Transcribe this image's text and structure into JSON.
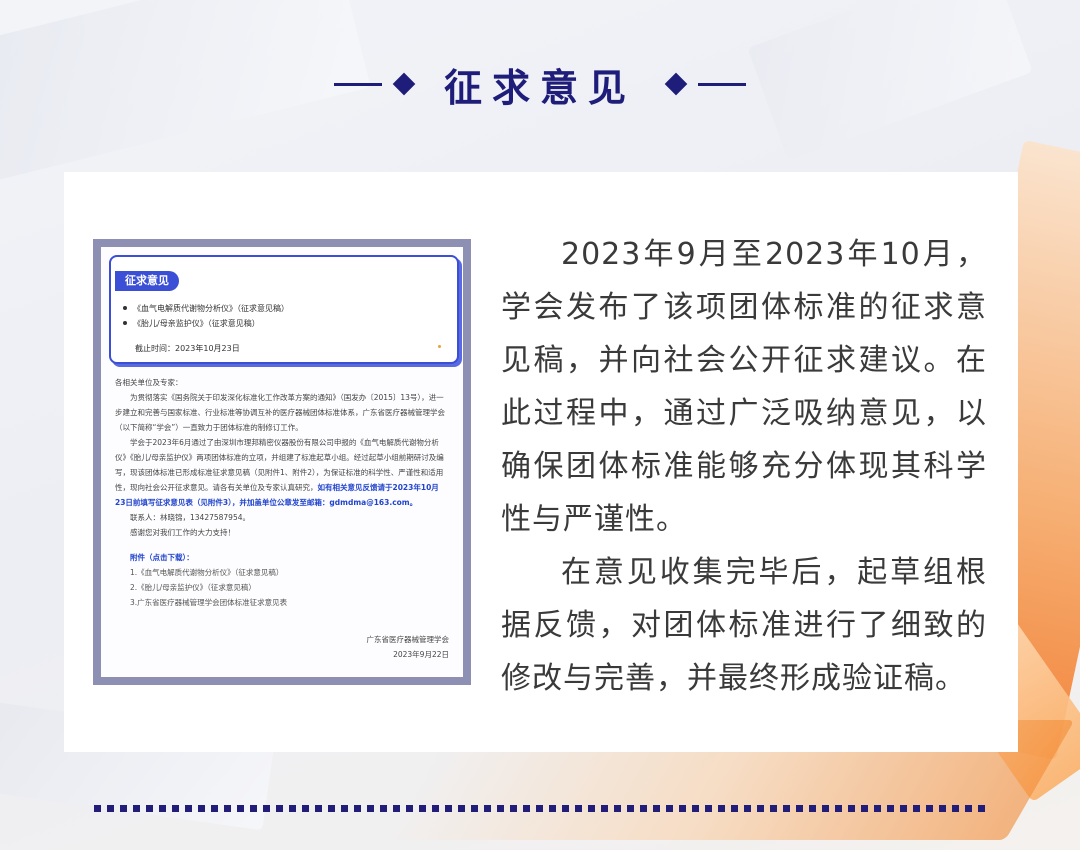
{
  "header": {
    "title": "征求意见"
  },
  "screenshot": {
    "notice": {
      "tab_label": "征求意见",
      "items": [
        "《血气电解质代谢物分析仪》（征求意见稿）",
        "《胎儿/母亲监护仪》（征求意见稿）"
      ],
      "deadline": "截止时间：2023年10月23日"
    },
    "letter": {
      "salutation": "各相关单位及专家：",
      "para1": "为贯彻落实《国务院关于印发深化标准化工作改革方案的通知》（国发办〔2015〕13号），进一步建立和完善与国家标准、行业标准等协调互补的医疗器械团体标准体系，广东省医疗器械管理学会（以下简称“学会”）一直致力于团体标准的制修订工作。",
      "para2": "学会于2023年6月通过了由深圳市理邦精密仪器股份有限公司申报的《血气电解质代谢物分析仪》《胎儿/母亲监护仪》两项团体标准的立项，并组建了标准起草小组。经过起草小组前期研讨及编写，现该团体标准已形成标准征求意见稿（见附件1、附件2），为保证标准的科学性、严谨性和适用性，现向社会公开征求意见。请各有关单位及专家认真研究，",
      "para2_highlight": "如有相关意见反馈请于2023年10月23日前填写征求意见表（见附件3），并加盖单位公章发至邮箱：gdmdma@163.com。",
      "contact": "联系人：林晓锦，13427587954。",
      "thanks": "感谢您对我们工作的大力支持！",
      "attachments_title": "附件（点击下载）：",
      "attachments": [
        "1.《血气电解质代谢物分析仪》（征求意见稿）",
        "2.《胎儿/母亲监护仪》（征求意见稿）",
        "3.广东省医疗器械管理学会团体标准征求意见表"
      ],
      "signature_org": "广东省医疗器械管理学会",
      "signature_date": "2023年9月22日"
    }
  },
  "body": {
    "paragraph1": "2023年9月至2023年10月，学会发布了该项团体标准的征求意见稿，并向社会公开征求建议。在此过程中，通过广泛吸纳意见，以确保团体标准能够充分体现其科学性与严谨性。",
    "paragraph2": "在意见收集完毕后，起草组根据反馈，对团体标准进行了细致的修改与完善，并最终形成验证稿。"
  }
}
